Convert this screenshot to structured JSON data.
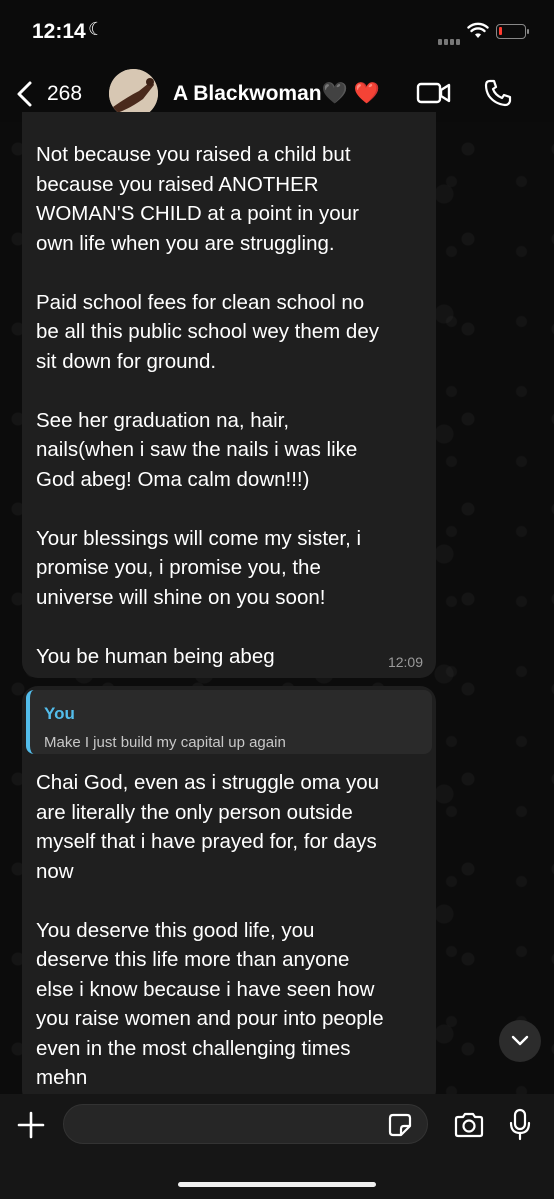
{
  "status_bar": {
    "time": "12:14",
    "battery_level": 0.12,
    "battery_color": "#ff3b30"
  },
  "header": {
    "back_count": "268",
    "contact_name": "A Blackwoman🖤 ❤️"
  },
  "messages": [
    {
      "direction": "incoming",
      "text": "Not because you raised a child but\nbecause you raised ANOTHER\nWOMAN'S CHILD at a point in your\nown life when you are struggling.\n\nPaid school fees for clean school no\nbe all this public school wey them dey\nsit down for ground.\n\nSee her graduation na, hair,\nnails(when i saw the nails i was like\nGod abeg! Oma calm down!!!)\n\nYour blessings will come my sister, i\npromise you, i promise you, the\nuniverse will shine on you soon!\n\nYou be human being abeg",
      "time": "12:09"
    },
    {
      "direction": "incoming",
      "reply_to": {
        "author": "You",
        "text": "Make I just build my capital up again"
      },
      "text": "Chai God, even as i struggle oma you\nare literally the only person outside\nmyself that i have prayed for, for days\nnow\n\nYou deserve this good life, you\ndeserve this life more than anyone\nelse i know because i have seen how\nyou raise women and pour into people\neven in the most challenging times\nmehn"
    }
  ],
  "composer": {
    "value": "",
    "placeholder": ""
  },
  "colors": {
    "accent": "#53bdeb",
    "bubble": "#1f1f1f",
    "background": "#0b0b0b"
  },
  "icons": [
    "moon-icon",
    "wifi-icon",
    "battery-icon",
    "back-chevron-icon",
    "video-call-icon",
    "phone-call-icon",
    "plus-icon",
    "sticker-icon",
    "camera-icon",
    "mic-icon",
    "chevron-down-icon"
  ]
}
